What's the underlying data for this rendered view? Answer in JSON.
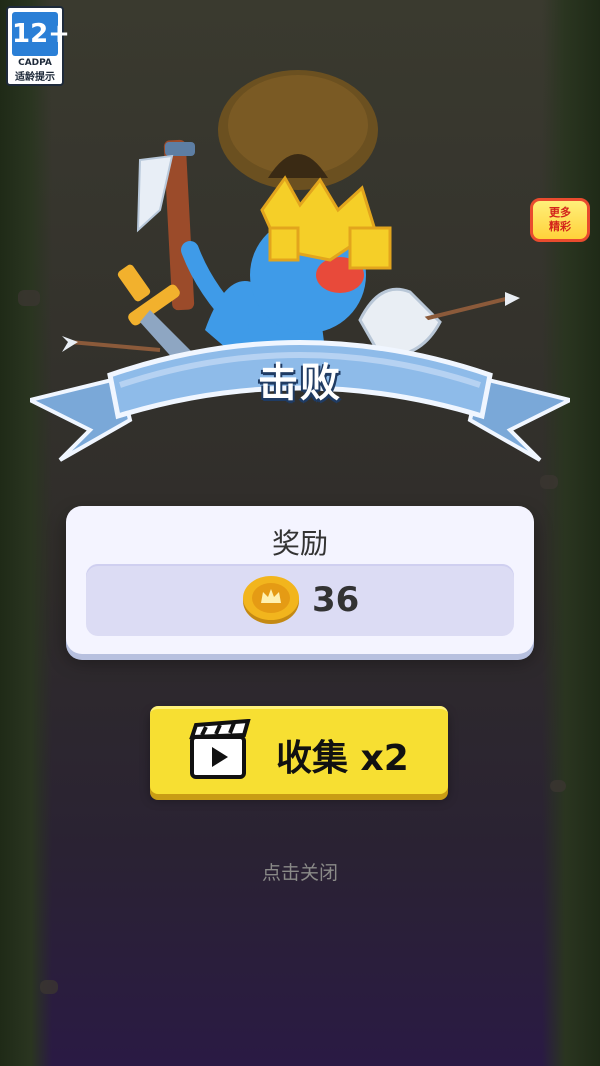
{
  "age_rating": {
    "number": "12+",
    "org": "CADPA",
    "tip": "适龄提示"
  },
  "more_games": {
    "line1": "更多",
    "line2": "精彩"
  },
  "result": {
    "title": "击败"
  },
  "reward": {
    "title": "奖励",
    "coin_amount": "36"
  },
  "collect_button": {
    "label": "收集 x2"
  },
  "close_text": "点击关闭",
  "colors": {
    "collect_bg": "#f7df32",
    "banner_blue": "#8ebbe9",
    "card_bg": "#f4f4ff",
    "coin_gold": "#f2b51d"
  },
  "icons": [
    "age-rating-icon",
    "clapperboard-icon",
    "coin-icon",
    "crown-icon",
    "pickaxe-icon",
    "sword-icon",
    "axe-icon",
    "arrow-icon"
  ]
}
